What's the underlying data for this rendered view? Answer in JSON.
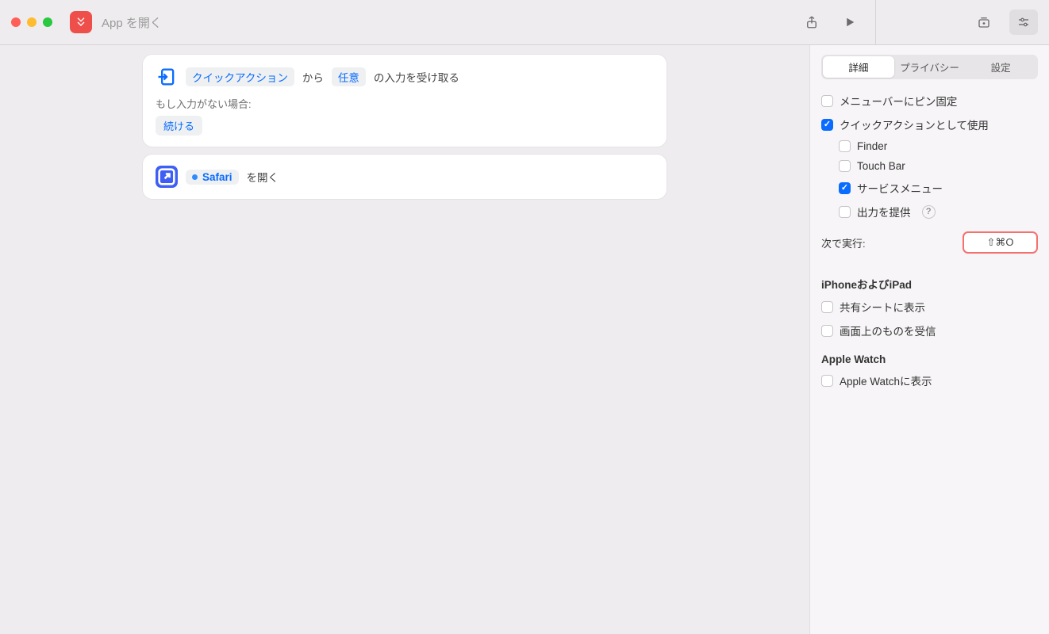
{
  "titlebar": {
    "app_title": "App を開く"
  },
  "actions": {
    "input_card": {
      "token_quick_action": "クイックアクション",
      "from_text": "から",
      "token_any": "任意",
      "accept_text": "の入力を受け取る",
      "subtitle": "もし入力がない場合:",
      "continue_btn": "続ける"
    },
    "open_card": {
      "app_name": "Safari",
      "open_text": "を開く"
    }
  },
  "sidebar": {
    "tabs": {
      "details": "詳細",
      "privacy": "プライバシー",
      "settings": "設定"
    },
    "checks": {
      "pin_menubar": "メニューバーにピン固定",
      "quick_action": "クイックアクションとして使用",
      "finder": "Finder",
      "touchbar": "Touch Bar",
      "services": "サービスメニュー",
      "output": "出力を提供"
    },
    "run_with_label": "次で実行:",
    "shortcut_value": "⇧⌘O",
    "section_iphone_ipad": "iPhoneおよびiPad",
    "share_sheet": "共有シートに表示",
    "receive_onscreen": "画面上のものを受信",
    "section_apple_watch": "Apple Watch",
    "apple_watch_show": "Apple Watchに表示"
  }
}
